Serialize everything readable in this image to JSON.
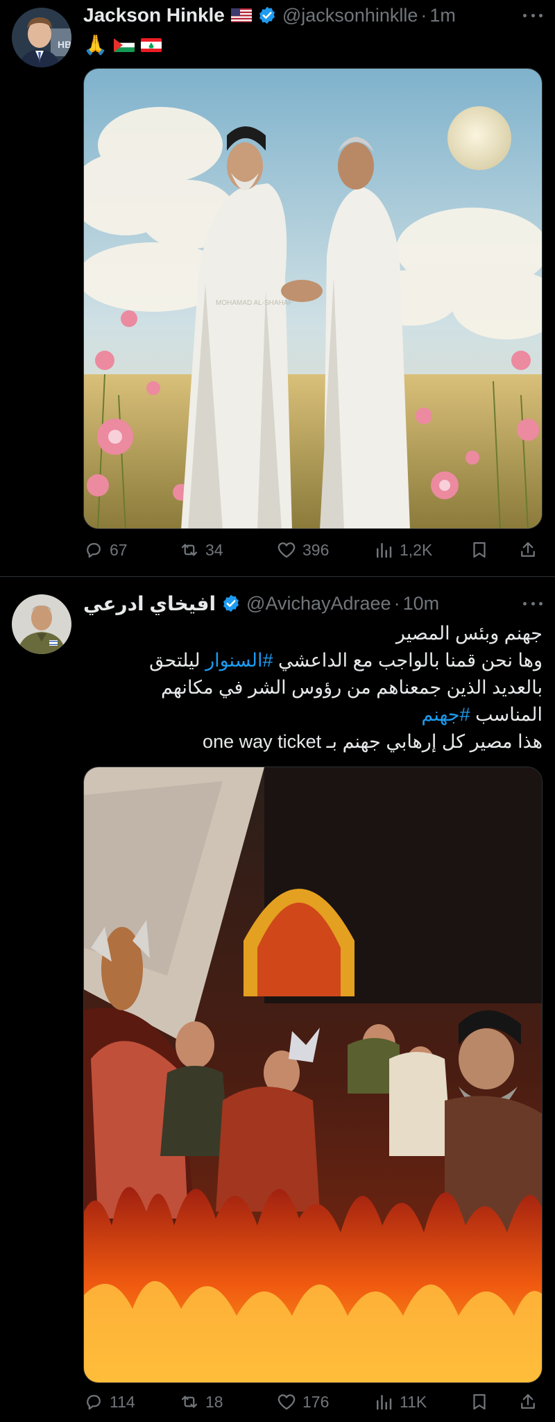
{
  "tweets": [
    {
      "author": {
        "name": "Jackson Hinkle",
        "handle": "@jacksonhinklle",
        "time": "1m",
        "verified": true,
        "name_flag": "us-flag"
      },
      "text_emojis": [
        "🙏",
        "palestine-flag",
        "lebanon-flag"
      ],
      "media": {
        "kind": "painting",
        "subject": "two robed men shaking hands in a flower field under clouds and moon"
      },
      "stats": {
        "replies": "67",
        "reposts": "34",
        "likes": "396",
        "views": "1,2K"
      }
    },
    {
      "author": {
        "name": "افيخاي ادرعي",
        "handle": "@AvichayAdraee",
        "time": "10m",
        "verified": true
      },
      "text_lines": [
        {
          "text": "جهنم وبئس المصير"
        },
        {
          "pre": "وها نحن قمنا بالواجب مع الداعشي ",
          "tag": "#السنوار",
          "post": " ليلتحق"
        },
        {
          "text": "بالعديد الذين جمعناهم من رؤوس الشر في مكانهم"
        },
        {
          "pre": "المناسب ",
          "tag": "#جهنم",
          "post": ""
        },
        {
          "text": "هذا مصير كل إرهابي جهنم بـ one way ticket"
        }
      ],
      "media": {
        "kind": "painting",
        "subject": "group of figures in flames before a glowing gate"
      },
      "stats": {
        "replies": "114",
        "reposts": "18",
        "likes": "176",
        "views": "11K"
      }
    }
  ],
  "colors": {
    "background": "#000000",
    "text": "#e7e9ea",
    "secondary": "#71767b",
    "accent": "#1d9bf0",
    "divider": "#2f3336"
  }
}
